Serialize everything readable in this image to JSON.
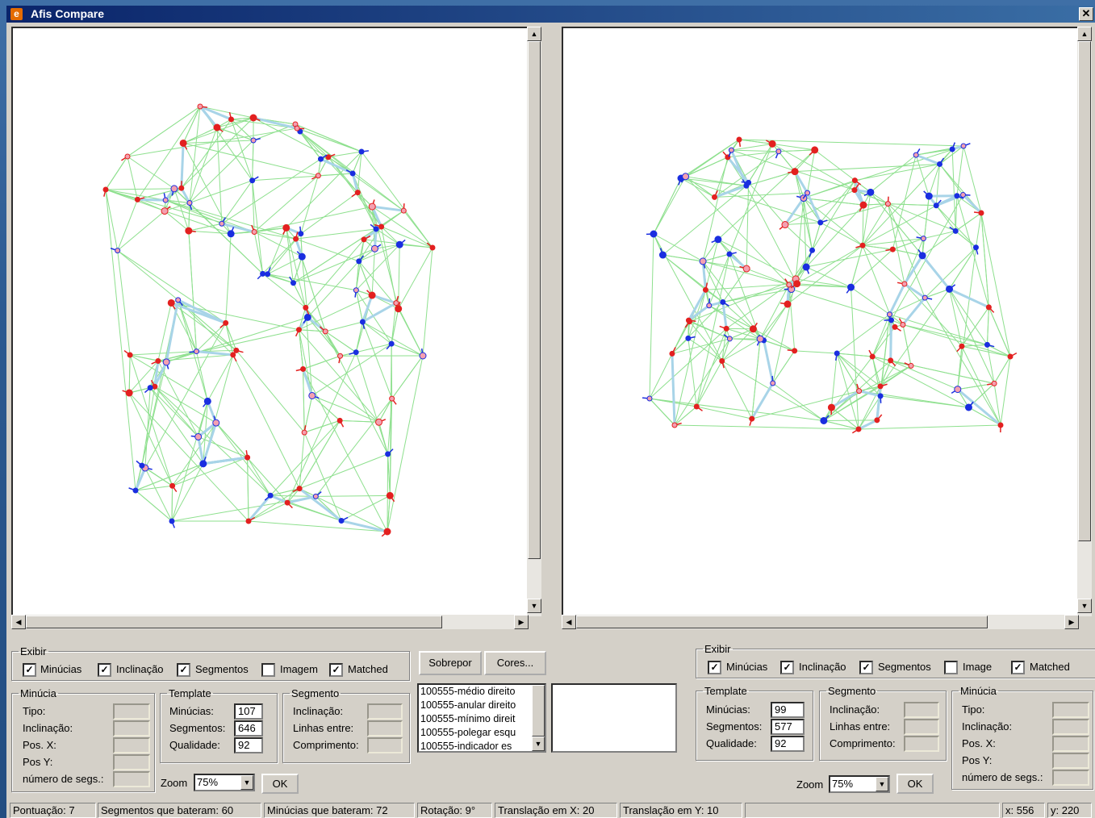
{
  "window": {
    "title": "Afis Compare",
    "close_glyph": "✕",
    "icon": "app-icon"
  },
  "left_panel": {
    "exibir": {
      "legend": "Exibir",
      "checks": [
        {
          "label": "Minúcias",
          "checked": true
        },
        {
          "label": "Inclinação",
          "checked": true
        },
        {
          "label": "Segmentos",
          "checked": true
        },
        {
          "label": "Imagem",
          "checked": false
        },
        {
          "label": "Matched",
          "checked": true
        }
      ]
    },
    "minucia": {
      "legend": "Minúcia",
      "tipo": "Tipo:",
      "inclinacao": "Inclinação:",
      "posx": "Pos. X:",
      "posy": "Pos Y:",
      "nsegs": "número de segs.:"
    },
    "template": {
      "legend": "Template",
      "minucias_label": "Minúcias:",
      "minucias": "107",
      "segmentos_label": "Segmentos:",
      "segmentos": "646",
      "qualidade_label": "Qualidade:",
      "qualidade": "92"
    },
    "segmento": {
      "legend": "Segmento",
      "inclinacao": "Inclinação:",
      "linhas": "Linhas entre:",
      "comprimento": "Comprimento:"
    },
    "zoom": {
      "label": "Zoom",
      "value": "75%",
      "ok": "OK"
    }
  },
  "right_panel": {
    "exibir": {
      "legend": "Exibir",
      "checks": [
        {
          "label": "Minúcias",
          "checked": true
        },
        {
          "label": "Inclinação",
          "checked": true
        },
        {
          "label": "Segmentos",
          "checked": true
        },
        {
          "label": "Image",
          "checked": false
        },
        {
          "label": "Matched",
          "checked": true
        }
      ]
    },
    "template": {
      "legend": "Template",
      "minucias_label": "Minúcias:",
      "minucias": "99",
      "segmentos_label": "Segmentos:",
      "segmentos": "577",
      "qualidade_label": "Qualidade:",
      "qualidade": "92"
    },
    "segmento": {
      "legend": "Segmento",
      "inclinacao": "Inclinação:",
      "linhas": "Linhas entre:",
      "comprimento": "Comprimento:"
    },
    "minucia": {
      "legend": "Minúcia",
      "tipo": "Tipo:",
      "inclinacao": "Inclinação:",
      "posx": "Pos. X:",
      "posy": "Pos Y:",
      "nsegs": "número de segs.:"
    },
    "zoom": {
      "label": "Zoom",
      "value": "75%",
      "ok": "OK"
    }
  },
  "center": {
    "sobrepor": "Sobrepor",
    "cores": "Cores...",
    "list": [
      "100555-médio direito",
      "100555-anular direito",
      "100555-mínimo direit",
      "100555-polegar esqu",
      "100555-indicador es"
    ]
  },
  "status": {
    "pontuacao": "Pontuação: 7",
    "segmentos": "Segmentos que bateram: 60",
    "minucias": "Minúcias que bateram: 72",
    "rotacao": "Rotação: 9°",
    "tx": "Translação em X: 20",
    "ty": "Translação em Y: 10",
    "x": "x: 556",
    "y": "y: 220"
  },
  "colors": {
    "mesh": "#8ee08e",
    "matched": "#a8d4e8",
    "minutia_red": "#e32020",
    "minutia_blue": "#1a2ee0"
  }
}
